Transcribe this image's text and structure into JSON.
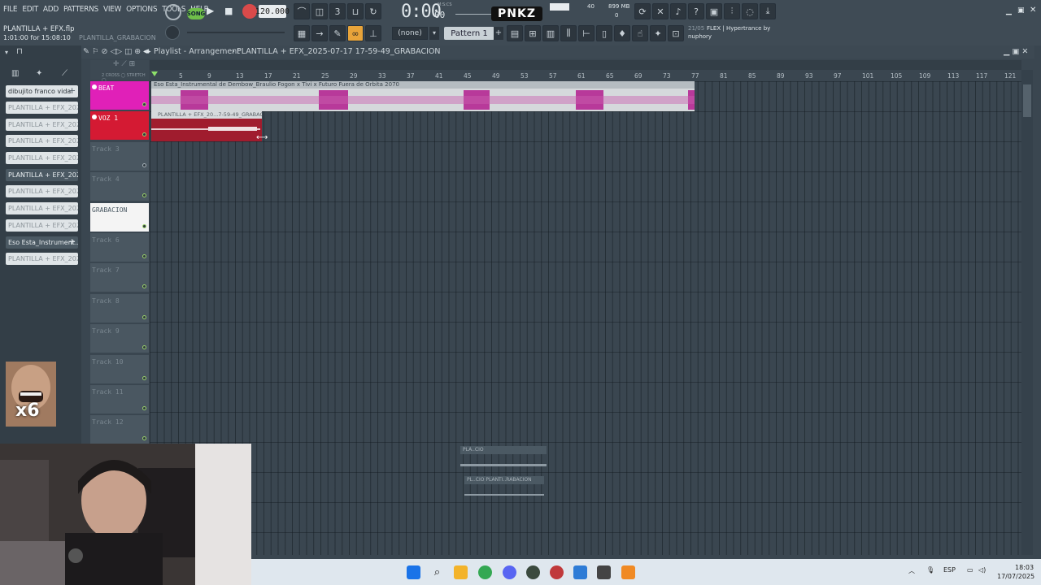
{
  "menu": [
    "FILE",
    "EDIT",
    "ADD",
    "PATTERNS",
    "VIEW",
    "OPTIONS",
    "TOOLS",
    "HELP"
  ],
  "project": {
    "file": "PLANTILLA + EFX.flp",
    "time": "1:01:00 for 15:08:10",
    "hint": "PLANTILLA_GRABACION"
  },
  "transport": {
    "song_label": "SONG",
    "tempo": "120.000",
    "time": "0:00",
    "time_small": "00",
    "time_unit": "M:S:CS"
  },
  "logo": "PNKZ",
  "cpu": {
    "value": "40",
    "mem": "899 MB",
    "poly": "0"
  },
  "toolbar": {
    "none_select": "(none)",
    "pattern": "Pattern 1",
    "flex_date": "21/05",
    "flex_text": "FLEX | Hypertrance by",
    "flex_author": "nuphory"
  },
  "playlist": {
    "title": "Playlist - Arrangement",
    "path": "PLANTILLA + EFX_2025-07-17 17-59-49_GRABACION"
  },
  "browser_items": [
    "dibujito franco vidal",
    "PLANTILLA + EFX_2025-0...",
    "PLANTILLA + EFX_2025-0...",
    "PLANTILLA + EFX_2025-0...",
    "PLANTILLA + EFX_2025-0...",
    "PLANTILLA + EFX_2025-0...",
    "PLANTILLA + EFX_2025-0...",
    "PLANTILLA + EFX_2025-0...",
    "PLANTILLA + EFX_2025-0...",
    "Eso Esta_Instrument...",
    "PLANTILLA + EFX_2025-0..."
  ],
  "ruler": [
    "5",
    "9",
    "13",
    "17",
    "21",
    "25",
    "29",
    "33",
    "37",
    "41",
    "45",
    "49",
    "53",
    "57",
    "61",
    "65",
    "69",
    "73",
    "77",
    "81",
    "85",
    "89",
    "93",
    "97",
    "101",
    "105",
    "109",
    "113",
    "117",
    "121"
  ],
  "tracks": [
    "BEAT",
    "VOZ 1",
    "Track 3",
    "Track 4",
    "GRABACION",
    "Track 6",
    "Track 7",
    "Track 8",
    "Track 9",
    "Track 10",
    "Track 11",
    "Track 12"
  ],
  "clips": {
    "beat": "Eso Esta_Instrumental de Dembow_Braulio Fogon x Tivi x Futuro Fuera de Orbita 2070",
    "voz": "PLANTILLA + EFX_20...7-59-49_GRABACION"
  },
  "floating": {
    "row1": "PLA..CIO",
    "row2": "PL..CIO  PLANTI..RABACION"
  },
  "meme_badge": "x6",
  "taskbar": {
    "lang": "ESP",
    "time": "18:03",
    "date": "17/07/2025"
  },
  "colors": {
    "beat": "#e020b8",
    "voz": "#d41a33",
    "grabacion": "#f4f4f4",
    "accent_green": "#6fbf4a"
  }
}
